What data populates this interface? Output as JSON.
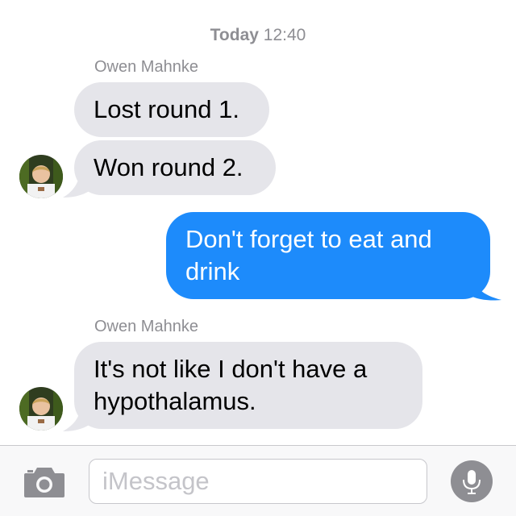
{
  "timestamp": {
    "day": "Today",
    "time": "12:40"
  },
  "thread": {
    "groups": [
      {
        "sender": "Owen Mahnke",
        "messages": [
          "Lost round 1.",
          "Won round 2."
        ]
      },
      {
        "outgoing": [
          "Don't forget to eat and drink"
        ]
      },
      {
        "sender": "Owen Mahnke",
        "messages": [
          "It's not like I don't have a hypothalamus."
        ]
      }
    ]
  },
  "composer": {
    "placeholder": "iMessage",
    "camera_icon": "camera-icon",
    "mic_icon": "microphone-icon"
  },
  "colors": {
    "incoming_bubble": "#e5e5ea",
    "outgoing_bubble": "#1d8bfb",
    "secondary_text": "#8e8e93"
  }
}
